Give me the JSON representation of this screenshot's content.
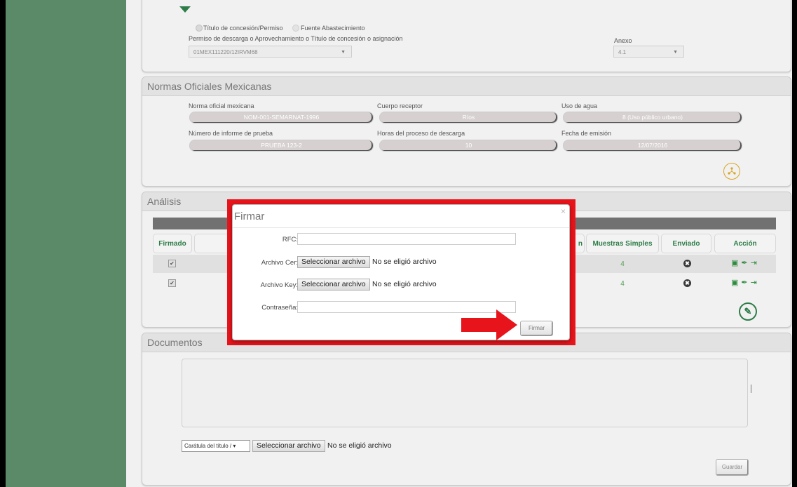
{
  "permiso": {
    "radio_titulo": "Título de concesión/Permiso",
    "radio_fuente": "Fuente Abastecimiento",
    "permiso_label": "Permiso de descarga o Aprovechamiento o Título de concesión o asignación",
    "permiso_value": "01MEX111220/12IRVM68",
    "anexo_label": "Anexo",
    "anexo_value": "4.1"
  },
  "normas": {
    "title": "Normas Oficiales Mexicanas",
    "fields": [
      {
        "label": "Norma oficial mexicana",
        "value": "NOM-001-SEMARNAT-1996"
      },
      {
        "label": "Cuerpo receptor",
        "value": "Ríos"
      },
      {
        "label": "Uso de agua",
        "value": "8 (Uso público urbano)"
      },
      {
        "label": "Número de informe de prueba",
        "value": "PRUEBA 123-2"
      },
      {
        "label": "Horas del proceso de descarga",
        "value": "10"
      },
      {
        "label": "Fecha de emisión",
        "value": "12/07/2016"
      }
    ]
  },
  "analisis": {
    "title": "Análisis",
    "headers": {
      "firmado": "Firmado",
      "partial": "n",
      "muestras": "Muestras Simples",
      "enviado": "Enviado",
      "accion": "Acción"
    },
    "rows": [
      {
        "firmado": "✔",
        "muestras": "4",
        "enviado": "✖"
      },
      {
        "firmado": "✔",
        "muestras": "4",
        "enviado": "✖"
      }
    ]
  },
  "modal": {
    "title": "Firmar",
    "close": "×",
    "rfc_label": "RFC:",
    "cer_label": "Archivo Cer:",
    "key_label": "Archivo Key:",
    "pass_label": "Contraseña:",
    "file_button": "Seleccionar archivo",
    "file_none": "No se eligió archivo",
    "submit": "Firmar"
  },
  "documentos": {
    "title": "Documentos",
    "select_value": "Carátula del título / ▾",
    "file_button": "Seleccionar archivo",
    "file_none": "No se eligió archivo",
    "save": "Guardar"
  },
  "colors": {
    "sidebar": "#5b8a68",
    "accent_green": "#2e7d48",
    "highlight_red": "#e8141b",
    "icon_gold": "#d9a520"
  },
  "icons": [
    "chevron-down-icon",
    "network-icon",
    "sign-icon",
    "close-icon",
    "document-icon",
    "pen-icon",
    "send-icon"
  ]
}
